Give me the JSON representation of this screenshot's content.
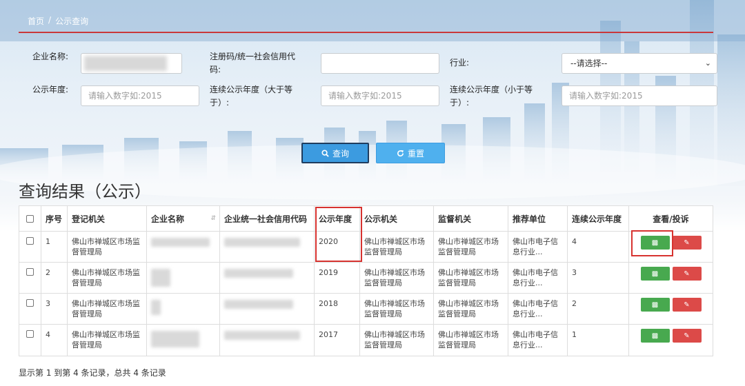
{
  "breadcrumb": {
    "home": "首页",
    "separator": "/",
    "current": "公示查询"
  },
  "form": {
    "company_name_label": "企业名称:",
    "reg_code_label": "注册码/统一社会信用代码:",
    "industry_label": "行业:",
    "industry_selected": "--请选择--",
    "year_label": "公示年度:",
    "year_placeholder": "请输入数字如:2015",
    "cont_min_label": "连续公示年度（大于等于）:",
    "cont_min_placeholder": "请输入数字如:2015",
    "cont_max_label": "连续公示年度（小于等于）:",
    "cont_max_placeholder": "请输入数字如:2015"
  },
  "buttons": {
    "query": "查询",
    "reset": "重置"
  },
  "section_title": "查询结果（公示）",
  "table": {
    "headers": [
      "序号",
      "登记机关",
      "企业名称",
      "企业统一社会信用代码",
      "公示年度",
      "公示机关",
      "监督机关",
      "推荐单位",
      "连续公示年度",
      "查看/投诉"
    ],
    "rows": [
      {
        "no": "1",
        "reg_org": "佛山市禅城区市场监督管理局",
        "year": "2020",
        "pub_org": "佛山市禅城区市场监督管理局",
        "sup_org": "佛山市禅城区市场监督管理局",
        "recommender": "佛山市电子信息行业...",
        "cont": "4"
      },
      {
        "no": "2",
        "reg_org": "佛山市禅城区市场监督管理局",
        "year": "2019",
        "pub_org": "佛山市禅城区市场监督管理局",
        "sup_org": "佛山市禅城区市场监督管理局",
        "recommender": "佛山市电子信息行业...",
        "cont": "3"
      },
      {
        "no": "3",
        "reg_org": "佛山市禅城区市场监督管理局",
        "year": "2018",
        "pub_org": "佛山市禅城区市场监督管理局",
        "sup_org": "佛山市禅城区市场监督管理局",
        "recommender": "佛山市电子信息行业...",
        "cont": "2"
      },
      {
        "no": "4",
        "reg_org": "佛山市禅城区市场监督管理局",
        "year": "2017",
        "pub_org": "佛山市禅城区市场监督管理局",
        "sup_org": "佛山市禅城区市场监督管理局",
        "recommender": "佛山市电子信息行业...",
        "cont": "1"
      }
    ]
  },
  "footer": "显示第 1 到第 4 条记录，总共 4 条记录",
  "colors": {
    "accent_red": "#c9373a",
    "query_blue": "#3c9be0",
    "view_green": "#48a94f",
    "complain_red": "#dc4a48"
  }
}
